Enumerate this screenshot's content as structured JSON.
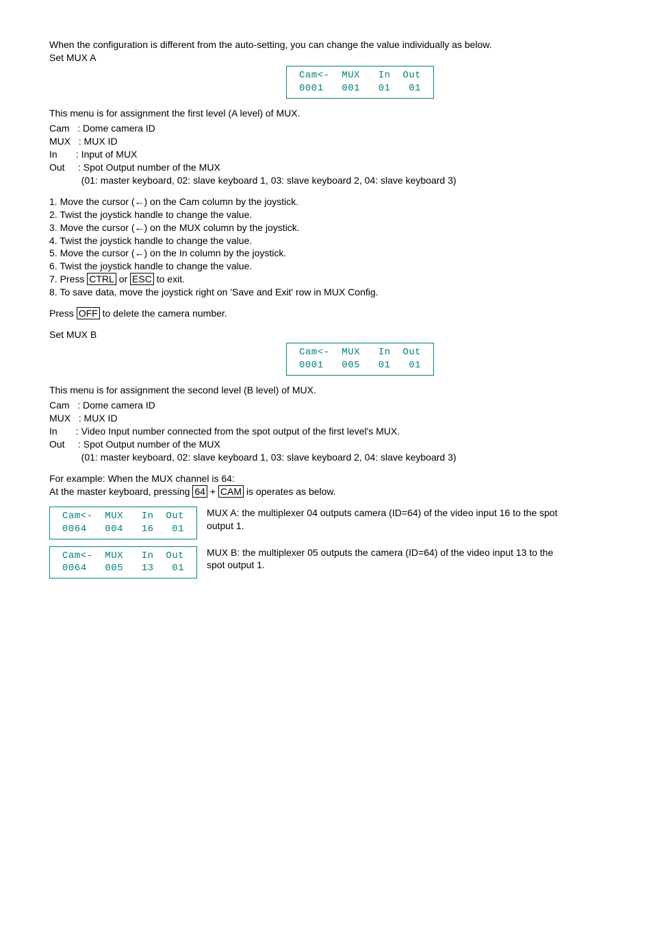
{
  "intro": "When the configuration is different from the auto-setting, you can change the value individually as below.",
  "setA_label": "Set MUX A",
  "boxA_line1": "Cam<-  MUX   In  Out",
  "boxA_line2": "0001   001   01   01",
  "menuA_intro": "This menu is for assignment the first level (A level) of MUX.",
  "defA_cam": "Cam   : Dome camera ID",
  "defA_mux": "MUX   : MUX ID",
  "defA_in": "In       : Input of MUX",
  "defA_out": "Out     : Spot Output number of the MUX",
  "defA_out2": "            (01: master keyboard, 02: slave keyboard 1, 03: slave keyboard 2, 04: slave keyboard 3)",
  "step1": "1. Move the cursor (←) on the Cam column by the joystick.",
  "step2": "2. Twist the joystick handle to change the value.",
  "step3": "3. Move the cursor (←) on the MUX column by the joystick.",
  "step4": "4. Twist the joystick handle to change the value.",
  "step5": "5. Move the cursor (←) on the In column by the joystick.",
  "step6": "6. Twist the joystick handle to change the value.",
  "step7_pre": "7. Press ",
  "key_ctrl": "CTRL",
  "step7_mid": " or ",
  "key_esc": "ESC",
  "step7_post": "   to exit.",
  "step8": "8. To save data, move the joystick right on 'Save and Exit' row in MUX Config.",
  "off_pre": "Press ",
  "key_off": "OFF",
  "off_post": " to delete the camera number.",
  "setB_label": "Set MUX B",
  "boxB_line1": "Cam<-  MUX   In  Out",
  "boxB_line2": "0001   005   01   01",
  "menuB_intro": "This menu is for assignment the second level (B level) of MUX.",
  "defB_cam": "Cam   : Dome camera ID",
  "defB_mux": "MUX   : MUX ID",
  "defB_in": "In       : Video Input number connected from the spot output of the first level's MUX.",
  "defB_out": "Out     : Spot Output number of the MUX",
  "defB_out2": "            (01: master keyboard, 02: slave keyboard 1, 03: slave keyboard 2, 04: slave keyboard 3)",
  "example_intro": "For example: When the MUX channel is 64:",
  "example_line_pre": "At the master keyboard, pressing ",
  "key_64": "64",
  "example_plus": " + ",
  "key_cam": "CAM",
  "example_line_post": " is operates as below.",
  "boxExA_line1": "Cam<-  MUX   In  Out",
  "boxExA_line2": "0064   004   16   01",
  "exA_text": "MUX A: the multiplexer 04 outputs camera (ID=64) of the video input 16 to the spot output 1.",
  "boxExB_line1": "Cam<-  MUX   In  Out",
  "boxExB_line2": "0064   005   13   01",
  "exB_text": "MUX B: the multiplexer 05 outputs the camera (ID=64) of the video input 13 to the spot output 1."
}
